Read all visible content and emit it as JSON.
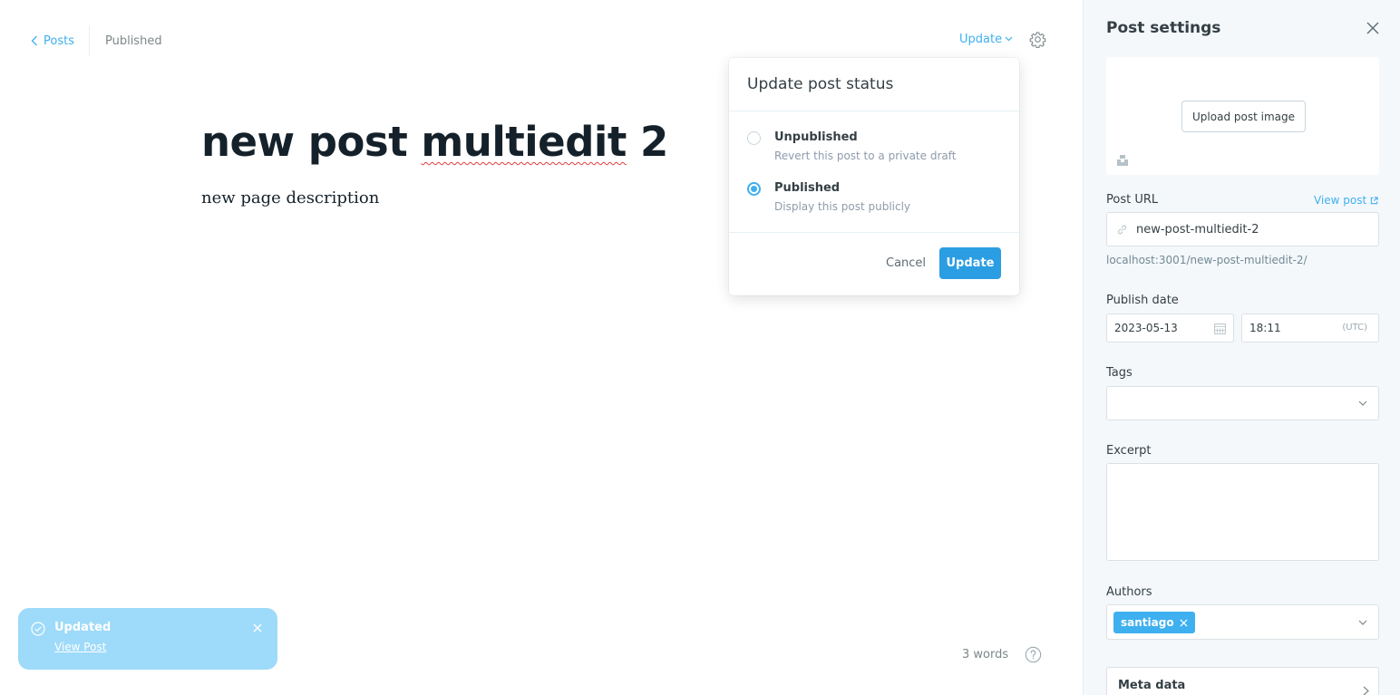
{
  "header": {
    "back_label": "Posts",
    "status": "Published",
    "update_menu_label": "Update",
    "settings_icon": "gear-icon"
  },
  "editor": {
    "title_prefix": "new post ",
    "title_misspelled": "multiedit",
    "title_suffix": " 2",
    "body": "new page description",
    "word_count": "3 words",
    "help_icon": "question-icon"
  },
  "popover": {
    "title": "Update post status",
    "options": [
      {
        "label": "Unpublished",
        "description": "Revert this post to a private draft",
        "selected": false
      },
      {
        "label": "Published",
        "description": "Display this post publicly",
        "selected": true
      }
    ],
    "cancel_label": "Cancel",
    "update_label": "Update"
  },
  "toast": {
    "title": "Updated",
    "link": "View Post",
    "color": "#9edaf9"
  },
  "settings": {
    "title": "Post settings",
    "upload_image_label": "Upload post image",
    "post_url_label": "Post URL",
    "view_post_label": "View post",
    "slug": "new-post-multiedit-2",
    "full_url": "localhost:3001/new-post-multiedit-2/",
    "publish_date_label": "Publish date",
    "date": "2023-05-13",
    "time": "18:11",
    "timezone": "(UTC)",
    "tags_label": "Tags",
    "excerpt_label": "Excerpt",
    "excerpt_value": "",
    "authors_label": "Authors",
    "authors": [
      "santiago"
    ],
    "meta_label": "Meta data"
  },
  "colors": {
    "accent": "#3eb0ef",
    "primary_button": "#2b9ee3",
    "panel_bg": "#f4f8fb"
  }
}
